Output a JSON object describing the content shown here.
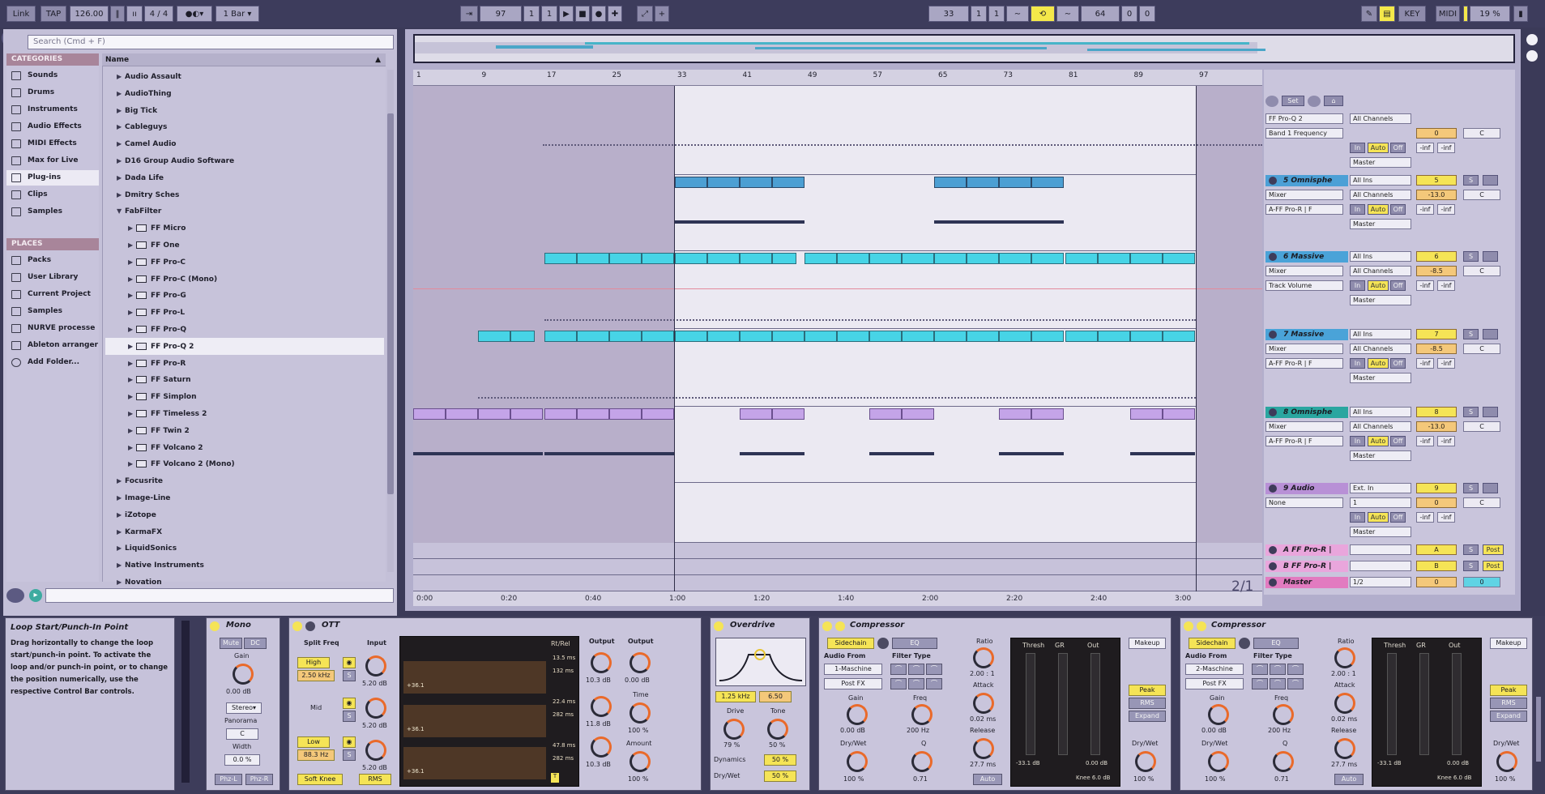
{
  "transport": {
    "link": "Link",
    "tap": "TAP",
    "tempo": "126.00",
    "time_sig": "4 / 4",
    "quantize": "1 Bar",
    "arrangement_position": [
      "97",
      "1",
      "1"
    ],
    "loop_start": [
      "33",
      "1",
      "1"
    ],
    "loop_length": [
      "64",
      "0",
      "0"
    ],
    "key": "KEY",
    "midi": "MIDI",
    "cpu": "19 %"
  },
  "browser": {
    "search_placeholder": "Search (Cmd + F)",
    "categories_header": "CATEGORIES",
    "categories": [
      {
        "label": "Sounds",
        "icon": "note-icon"
      },
      {
        "label": "Drums",
        "icon": "drums-grid-icon"
      },
      {
        "label": "Instruments",
        "icon": "wave-icon"
      },
      {
        "label": "Audio Effects",
        "icon": "audio-fx-icon"
      },
      {
        "label": "MIDI Effects",
        "icon": "midi-fx-icon"
      },
      {
        "label": "Max for Live",
        "icon": "max-icon"
      },
      {
        "label": "Plug-ins",
        "icon": "plugin-icon"
      },
      {
        "label": "Clips",
        "icon": "clip-icon"
      },
      {
        "label": "Samples",
        "icon": "sample-icon"
      }
    ],
    "places_header": "PLACES",
    "places": [
      {
        "label": "Packs",
        "icon": "folder-icon"
      },
      {
        "label": "User Library",
        "icon": "user-icon"
      },
      {
        "label": "Current Project",
        "icon": "folder-icon"
      },
      {
        "label": "Samples",
        "icon": "folder-icon"
      },
      {
        "label": "NURVE processe",
        "icon": "folder-icon"
      },
      {
        "label": "Ableton arranger",
        "icon": "folder-icon"
      },
      {
        "label": "Add Folder...",
        "icon": "plus-circle-icon"
      }
    ],
    "name_header": "Name",
    "items": [
      {
        "label": "Audio Assault",
        "level": 0
      },
      {
        "label": "AudioThing",
        "level": 0
      },
      {
        "label": "Big Tick",
        "level": 0
      },
      {
        "label": "Cableguys",
        "level": 0
      },
      {
        "label": "Camel Audio",
        "level": 0
      },
      {
        "label": "D16 Group Audio Software",
        "level": 0
      },
      {
        "label": "Dada Life",
        "level": 0
      },
      {
        "label": "Dmitry Sches",
        "level": 0
      },
      {
        "label": "FabFilter",
        "level": 0,
        "open": true
      },
      {
        "label": "FF Micro",
        "level": 1
      },
      {
        "label": "FF One",
        "level": 1
      },
      {
        "label": "FF Pro-C",
        "level": 1
      },
      {
        "label": "FF Pro-C (Mono)",
        "level": 1
      },
      {
        "label": "FF Pro-G",
        "level": 1
      },
      {
        "label": "FF Pro-L",
        "level": 1
      },
      {
        "label": "FF Pro-Q",
        "level": 1
      },
      {
        "label": "FF Pro-Q 2",
        "level": 1,
        "selected": true
      },
      {
        "label": "FF Pro-R",
        "level": 1
      },
      {
        "label": "FF Saturn",
        "level": 1
      },
      {
        "label": "FF Simplon",
        "level": 1
      },
      {
        "label": "FF Timeless 2",
        "level": 1
      },
      {
        "label": "FF Twin 2",
        "level": 1
      },
      {
        "label": "FF Volcano 2",
        "level": 1
      },
      {
        "label": "FF Volcano 2 (Mono)",
        "level": 1
      },
      {
        "label": "Focusrite",
        "level": 0
      },
      {
        "label": "Image-Line",
        "level": 0
      },
      {
        "label": "iZotope",
        "level": 0
      },
      {
        "label": "KarmaFX",
        "level": 0
      },
      {
        "label": "LiquidSonics",
        "level": 0
      },
      {
        "label": "Native Instruments",
        "level": 0
      },
      {
        "label": "Novation",
        "level": 0
      }
    ]
  },
  "arrangement": {
    "bar_numbers": [
      "1",
      "9",
      "17",
      "25",
      "33",
      "41",
      "49",
      "57",
      "65",
      "73",
      "81",
      "89",
      "97"
    ],
    "time_labels": [
      "0:00",
      "0:20",
      "0:40",
      "1:00",
      "1:20",
      "1:40",
      "2:00",
      "2:20",
      "2:40",
      "3:00"
    ],
    "zoom_ratio": "2/1",
    "tracks": [
      {
        "name": "",
        "device": "FF Pro-Q 2",
        "param": "Band 1 Frequency",
        "input": "All Channels",
        "output": "Master",
        "volume": "0",
        "pan": "C",
        "sends": [
          "-inf",
          "-inf"
        ]
      },
      {
        "name": "5 Omnisphe",
        "input": "All Ins",
        "channel": "All Channels",
        "device": "Mixer",
        "param": "A-FF Pro-R | F",
        "output": "Master",
        "number": "5",
        "volume": "-13.0",
        "pan": "C",
        "sends": [
          "-inf",
          "-inf"
        ],
        "color": "#4ca0d6"
      },
      {
        "name": "6 Massive",
        "input": "All Ins",
        "channel": "All Channels",
        "device": "Mixer",
        "param": "Track Volume",
        "output": "Master",
        "number": "6",
        "volume": "-8.5",
        "pan": "C",
        "sends": [
          "-inf",
          "-inf"
        ],
        "color": "#4aa3d8"
      },
      {
        "name": "7 Massive",
        "input": "All Ins",
        "channel": "All Channels",
        "device": "Mixer",
        "param": "A-FF Pro-R | F",
        "output": "Master",
        "number": "7",
        "volume": "-8.5",
        "pan": "C",
        "sends": [
          "-inf",
          "-inf"
        ],
        "color": "#4aa3d8"
      },
      {
        "name": "8 Omnisphe",
        "input": "All Ins",
        "channel": "All Channels",
        "device": "Mixer",
        "param": "A-FF Pro-R | F",
        "output": "Master",
        "number": "8",
        "volume": "-13.0",
        "pan": "C",
        "sends": [
          "-inf",
          "-inf"
        ],
        "color": "#2aa6a0"
      },
      {
        "name": "9 Audio",
        "input": "Ext. In",
        "channel": "1",
        "device": "None",
        "param": "",
        "output": "Master",
        "number": "9",
        "volume": "0",
        "pan": "C",
        "sends": [
          "-inf",
          "-inf"
        ],
        "color": "#b890d6"
      }
    ],
    "returns": [
      {
        "name": "A FF Pro-R |",
        "letter": "A",
        "button": "Post"
      },
      {
        "name": "B FF Pro-R |",
        "letter": "B",
        "button": "Post"
      }
    ],
    "master": {
      "name": "Master",
      "output": "1/2",
      "volume": "0",
      "level": "0"
    },
    "track_buttons": {
      "in": "In",
      "auto": "Auto",
      "off": "Off",
      "set": "Set",
      "solo": "S"
    }
  },
  "info_view": {
    "title": "Loop Start/Punch-In Point",
    "text": "Drag horizontally to change the loop start/punch-in point. To activate the loop and/or punch-in point, or to change the position numerically, use the respective Control Bar controls."
  },
  "devices": {
    "mono": {
      "title": "Mono",
      "buttons": [
        "Mute",
        "DC"
      ],
      "gain_label": "Gain",
      "gain": "0.00 dB",
      "mode": "Stereo",
      "panorama_label": "Panorama",
      "panorama": "C",
      "width_label": "Width",
      "width": "0.0 %",
      "phase_buttons": [
        "Phz-L",
        "Phz-R"
      ]
    },
    "ott": {
      "title": "OTT",
      "split_label": "Split Freq",
      "input_label": "Input",
      "high": "High",
      "high_freq": "2.50 kHz",
      "mid": "Mid",
      "low": "Low",
      "low_freq": "88.3 Hz",
      "input_values": [
        "5.20 dB",
        "5.20 dB",
        "5.20 dB"
      ],
      "display_header": "Rt/Rel",
      "attack_release": [
        "13.5 ms",
        "132 ms",
        "22.4 ms",
        "282 ms",
        "47.8 ms",
        "282 ms"
      ],
      "db_ticks": [
        "+36.1",
        "+36.1",
        "+36.1"
      ],
      "output_label": "Output",
      "output_values": [
        "10.3 dB",
        "11.8 dB",
        "10.3 dB"
      ],
      "out2_label": "Output",
      "out2": "0.00 dB",
      "time_label": "Time",
      "time": "100 %",
      "amount_label": "Amount",
      "amount": "100 %",
      "soft_knee": "Soft Knee",
      "rms": "RMS",
      "t_buttons": [
        "T"
      ]
    },
    "overdrive": {
      "title": "Overdrive",
      "freq": "1.25 kHz",
      "bw": "6.50",
      "drive_label": "Drive",
      "drive": "79 %",
      "tone_label": "Tone",
      "tone": "50 %",
      "dynamics_label": "Dynamics",
      "dynamics": "50 %",
      "drywet_label": "Dry/Wet",
      "drywet": "50 %"
    },
    "compressors": [
      {
        "title": "Compressor",
        "sidechain": "Sidechain",
        "eq": "EQ",
        "audio_from_label": "Audio From",
        "audio_from": "1-Maschine",
        "post_fx": "Post FX",
        "gain_label": "Gain",
        "gain": "0.00 dB",
        "drywet_label": "Dry/Wet",
        "drywet": "100 %",
        "filter_type_label": "Filter Type",
        "freq_label": "Freq",
        "freq": "200 Hz",
        "q_label": "Q",
        "q": "0.71",
        "ratio_label": "Ratio",
        "ratio": "2.00 : 1",
        "attack_label": "Attack",
        "attack": "0.02 ms",
        "release_label": "Release",
        "release": "27.7 ms",
        "auto": "Auto",
        "meters": [
          "Thresh",
          "GR",
          "Out"
        ],
        "thresh": "-33.1 dB",
        "out": "0.00 dB",
        "knee": "Knee 6.0 dB",
        "makeup": "Makeup",
        "peak": "Peak",
        "rms": "RMS",
        "expand": "Expand",
        "out_drywet_label": "Dry/Wet",
        "out_drywet": "100 %"
      },
      {
        "title": "Compressor",
        "sidechain": "Sidechain",
        "eq": "EQ",
        "audio_from_label": "Audio From",
        "audio_from": "2-Maschine",
        "post_fx": "Post FX",
        "gain_label": "Gain",
        "gain": "0.00 dB",
        "drywet_label": "Dry/Wet",
        "drywet": "100 %",
        "filter_type_label": "Filter Type",
        "freq_label": "Freq",
        "freq": "200 Hz",
        "q_label": "Q",
        "q": "0.71",
        "ratio_label": "Ratio",
        "ratio": "2.00 : 1",
        "attack_label": "Attack",
        "attack": "0.02 ms",
        "release_label": "Release",
        "release": "27.7 ms",
        "auto": "Auto",
        "meters": [
          "Thresh",
          "GR",
          "Out"
        ],
        "thresh": "-33.1 dB",
        "out": "0.00 dB",
        "knee": "Knee 6.0 dB",
        "makeup": "Makeup",
        "peak": "Peak",
        "rms": "RMS",
        "expand": "Expand",
        "out_drywet_label": "Dry/Wet",
        "out_drywet": "100 %"
      }
    ]
  },
  "colors": {
    "accent_yellow": "#f5e456",
    "clip_blue": "#4c9fd3",
    "clip_cyan": "#47d4e6",
    "clip_violet": "#c4a4e8",
    "selection_orange": "#f4c87a"
  }
}
